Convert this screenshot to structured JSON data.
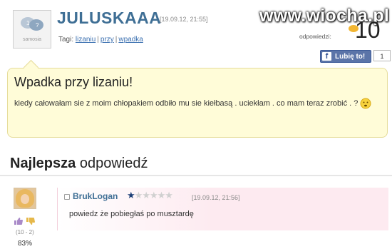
{
  "watermark": "www.wiocha.pl",
  "post": {
    "avatar_label": "samosia",
    "username": "JULUSKAAA",
    "date": "[19.09.12, 21:55]",
    "tags_label": "Tagi:",
    "tags": [
      "lizaniu",
      "przy",
      "wpadka"
    ],
    "answers_label": "odpowiedzi:",
    "answers_count": "10",
    "like_label": "Lubię to!",
    "like_count": "1"
  },
  "question": {
    "title": "Wpadka przy lizaniu!",
    "body": "kiedy całowałam sie z moim chłopakiem odbiło mu sie kiełbasą . uciekłam . co mam teraz zrobić . ?"
  },
  "best_answer": {
    "heading_bold": "Najlepsza",
    "heading_rest": "odpowiedź",
    "author": "BrukLogan",
    "rating": {
      "filled": 1,
      "total": 6
    },
    "date": "[19.09.12, 21:56]",
    "text": "powiedz że pobiegłaś po musztardę",
    "votes": "(10 - 2)",
    "percent": "83%"
  },
  "icons": [
    "speech-bubbles-icon",
    "facebook-icon",
    "answers-icon",
    "emoji-icon",
    "thumbs-up-icon",
    "thumbs-down-icon",
    "star-icon"
  ],
  "colors": {
    "username": "#3f6f95",
    "question_bg": "#fffcd8",
    "answer_bg": "#fdeaf0",
    "facebook": "#3b5998"
  }
}
